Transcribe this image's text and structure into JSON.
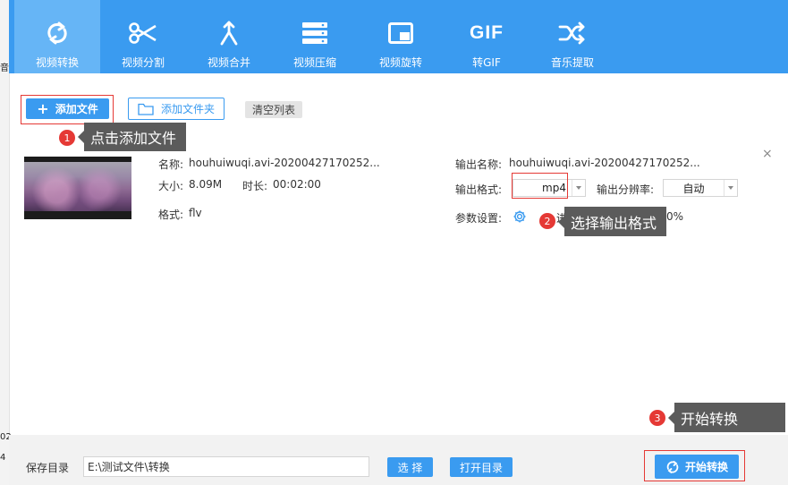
{
  "edge": {
    "top_char": "音",
    "mid_char": "02",
    "low_char": "4"
  },
  "toolbar": {
    "tools": [
      {
        "label": "视频转换",
        "icon": "convert-icon",
        "active": true
      },
      {
        "label": "视频分割",
        "icon": "scissors-icon",
        "active": false
      },
      {
        "label": "视频合并",
        "icon": "merge-icon",
        "active": false
      },
      {
        "label": "视频压缩",
        "icon": "compress-icon",
        "active": false
      },
      {
        "label": "视频旋转",
        "icon": "rotate-icon",
        "active": false
      },
      {
        "label": "转GIF",
        "icon_text": "GIF",
        "active": false
      },
      {
        "label": "音乐提取",
        "icon": "shuffle-icon",
        "active": false
      }
    ],
    "accent": "#3a9bf0"
  },
  "actions": {
    "add_file": "添加文件",
    "add_folder": "添加文件夹",
    "clear_list": "清空列表"
  },
  "callouts": [
    {
      "num": "1",
      "text": "点击添加文件"
    },
    {
      "num": "2",
      "text": "选择输出格式"
    },
    {
      "num": "3",
      "text": "开始转换"
    }
  ],
  "file": {
    "name_label": "名称:",
    "name_value": "houhuiwuqi.avi-20200427170252...",
    "size_label": "大小:",
    "size_value": "8.09M",
    "duration_label": "时长:",
    "duration_value": "00:02:00",
    "format_label": "格式:",
    "format_value": "flv"
  },
  "output": {
    "name_label": "输出名称:",
    "name_value": "houhuiwuqi.avi-20200427170252...",
    "format_label": "输出格式:",
    "format_value": "mp4",
    "resolution_label": "输出分辨率:",
    "resolution_value": "自动",
    "params_label": "参数设置:",
    "progress_partial_left": "进",
    "progress_partial_right": "0%"
  },
  "bottom": {
    "save_dir_label": "保存目录",
    "save_dir_value": "E:\\测试文件\\转换",
    "choose_btn": "选 择",
    "open_dir_btn": "打开目录",
    "start_btn": "开始转换"
  },
  "colors": {
    "primary": "#3a9bf0",
    "highlight_red": "#e53935",
    "callout_bg": "#5b5b5b"
  }
}
